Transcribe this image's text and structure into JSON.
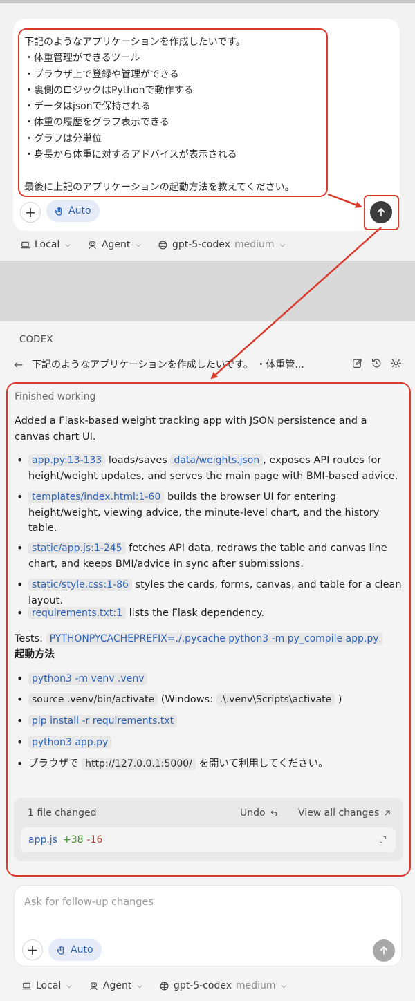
{
  "composer": {
    "prompt_lines": [
      "下記のようなアプリケーションを作成したいです。",
      "・体重管理ができるツール",
      "・ブラウザ上で登録や管理ができる",
      "・裏側のロジックはPythonで動作する",
      "・データはjsonで保持される",
      "・体重の履歴をグラフ表示できる",
      "・グラフは分単位",
      "・身長から体重に対するアドバイスが表示される",
      "",
      "最後に上記のアプリケーションの起動方法を教えてください。"
    ],
    "plus_label": "+",
    "auto_label": "Auto"
  },
  "footer": {
    "local_label": "Local",
    "agent_label": "Agent",
    "model_label": "gpt-5-codex",
    "effort_label": "medium"
  },
  "panel": {
    "app_label": "CODEX",
    "back_label": "←",
    "thread_title": "下記のようなアプリケーションを作成したいです。 ・体重管..."
  },
  "result": {
    "status": "Finished working",
    "summary": "Added a Flask-based weight tracking app with JSON persistence and a canvas chart UI.",
    "bullets": [
      {
        "ref": "app.py:13-133",
        "text1": " loads/saves ",
        "ref2": "data/weights.json",
        "text2": ", exposes API routes for height/weight updates, and serves the main page with BMI-based advice."
      },
      {
        "ref": "templates/index.html:1-60",
        "text1": " builds the browser UI for entering height/weight, viewing advice, the minute-level chart, and the history table."
      },
      {
        "ref": "static/app.js:1-245",
        "text1": " fetches API data, redraws the table and canvas line chart, and keeps BMI/advice in sync after submissions."
      },
      {
        "ref": "static/style.css:1-86",
        "text1": " styles the cards, forms, canvas, and table for a clean layout."
      },
      {
        "ref": "requirements.txt:1",
        "text1": " lists the Flask dependency."
      }
    ],
    "tests_label": "Tests: ",
    "tests_command": "PYTHONPYCACHEPREFIX=./.pycache python3 -m py_compile app.py",
    "startup_heading": "起動方法",
    "startup_steps": [
      {
        "code": "python3 -m venv .venv"
      },
      {
        "code": "source .venv/bin/activate",
        "text1": " (Windows: ",
        "code2": ".\\.venv\\Scripts\\activate",
        "text2": " )"
      },
      {
        "code": "pip install -r requirements.txt"
      },
      {
        "code": "python3 app.py"
      },
      {
        "text0": "ブラウザで ",
        "code": "http://127.0.0.1:5000/",
        "text1": " を開いて利用してください。"
      }
    ],
    "changes": {
      "count": "1 file changed",
      "undo_label": "Undo",
      "view_all_label": "View all changes",
      "file": {
        "name": "app.js",
        "added": "+38",
        "removed": "-16"
      }
    }
  },
  "followup": {
    "placeholder": "Ask for follow-up changes",
    "plus_label": "+",
    "auto_label": "Auto"
  },
  "colors": {
    "annotation_red": "#d93a2e",
    "link_blue": "#2f63b5",
    "added_green": "#3f8f2f",
    "removed_red": "#b03b2e"
  }
}
